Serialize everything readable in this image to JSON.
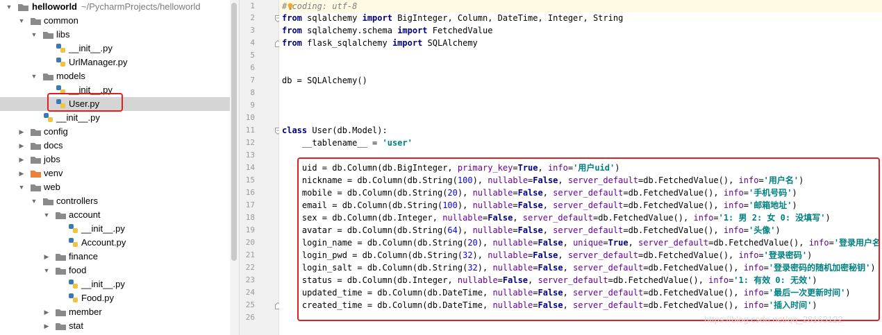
{
  "project": {
    "name": "helloworld",
    "path": "~/PycharmProjects/helloworld"
  },
  "tree": [
    {
      "label": "common"
    },
    {
      "label": "libs"
    },
    {
      "label": "__init__.py"
    },
    {
      "label": "UrlManager.py"
    },
    {
      "label": "models"
    },
    {
      "label": "__init__.py"
    },
    {
      "label": "User.py"
    },
    {
      "label": "__init__.py"
    },
    {
      "label": "config"
    },
    {
      "label": "docs"
    },
    {
      "label": "jobs"
    },
    {
      "label": "venv"
    },
    {
      "label": "web"
    },
    {
      "label": "controllers"
    },
    {
      "label": "account"
    },
    {
      "label": "__init__.py"
    },
    {
      "label": "Account.py"
    },
    {
      "label": "finance"
    },
    {
      "label": "food"
    },
    {
      "label": "__init__.py"
    },
    {
      "label": "Food.py"
    },
    {
      "label": "member"
    },
    {
      "label": "stat"
    }
  ],
  "line_numbers": [
    "1",
    "2",
    "3",
    "4",
    "5",
    "6",
    "7",
    "8",
    "9",
    "10",
    "11",
    "12",
    "13",
    "14",
    "15",
    "16",
    "17",
    "18",
    "19",
    "20",
    "21",
    "22",
    "23",
    "24",
    "25",
    "26"
  ],
  "code": {
    "l1": "# coding: utf-8",
    "l2a": "from",
    "l2b": " sqlalchemy ",
    "l2c": "import",
    "l2d": " BigInteger, Column, DateTime, Integer, String",
    "l3a": "from",
    "l3b": " sqlalchemy.schema ",
    "l3c": "import",
    "l3d": " FetchedValue",
    "l4a": "from",
    "l4b": " flask_sqlalchemy ",
    "l4c": "import",
    "l4d": " SQLAlchemy",
    "l7": "db = SQLAlchemy()",
    "l11a": "class",
    "l11b": " User(db.Model):",
    "l12a": "    __tablename__ = ",
    "l12b": "'user'",
    "f_uid": "    uid = db.Column(db.BigInteger, ",
    "f_nickname": "    nickname = db.Column(db.String(",
    "f_mobile": "    mobile = db.Column(db.String(",
    "f_email": "    email = db.Column(db.String(",
    "f_sex": "    sex = db.Column(db.Integer, ",
    "f_avatar": "    avatar = db.Column(db.String(",
    "f_login_name": "    login_name = db.Column(db.String(",
    "f_login_pwd": "    login_pwd = db.Column(db.String(",
    "f_login_salt": "    login_salt = db.Column(db.String(",
    "f_status": "    status = db.Column(db.Integer, ",
    "f_updated_time": "    updated_time = db.Column(db.DateTime, ",
    "f_created_time": "    created_time = db.Column(db.DateTime, ",
    "n100": "100",
    "n20": "20",
    "n64": "64",
    "n32": "32",
    "close_comma": "), ",
    "primary_key": "primary_key",
    "nullable": "nullable",
    "unique": "unique",
    "server_default": "server_default",
    "info": "info",
    "eq": "=",
    "True": "True",
    "False": "False",
    "comma": ", ",
    "fv": "db.FetchedValue(), ",
    "close": ")",
    "info_uid": "'用户uid'",
    "info_nickname": "'用户名'",
    "info_mobile": "'手机号码'",
    "info_email": "'邮箱地址'",
    "info_sex": "'1: 男 2: 女 0: 没填写'",
    "info_avatar": "'头像'",
    "info_login_name": "'登录用户名'",
    "info_login_pwd": "'登录密码'",
    "info_login_salt": "'登录密码的随机加密秘钥'",
    "info_status": "'1: 有效 0: 无效'",
    "info_updated_time": "'最后一次更新时间'",
    "info_created_time": "'插入时间'"
  },
  "watermark": "https://blog.csdn.net/qq_28163122",
  "colors": {
    "highlight": "#e02020",
    "keyword": "#000080",
    "string": "#008080",
    "number": "#0000ff",
    "kwarg": "#660099"
  }
}
